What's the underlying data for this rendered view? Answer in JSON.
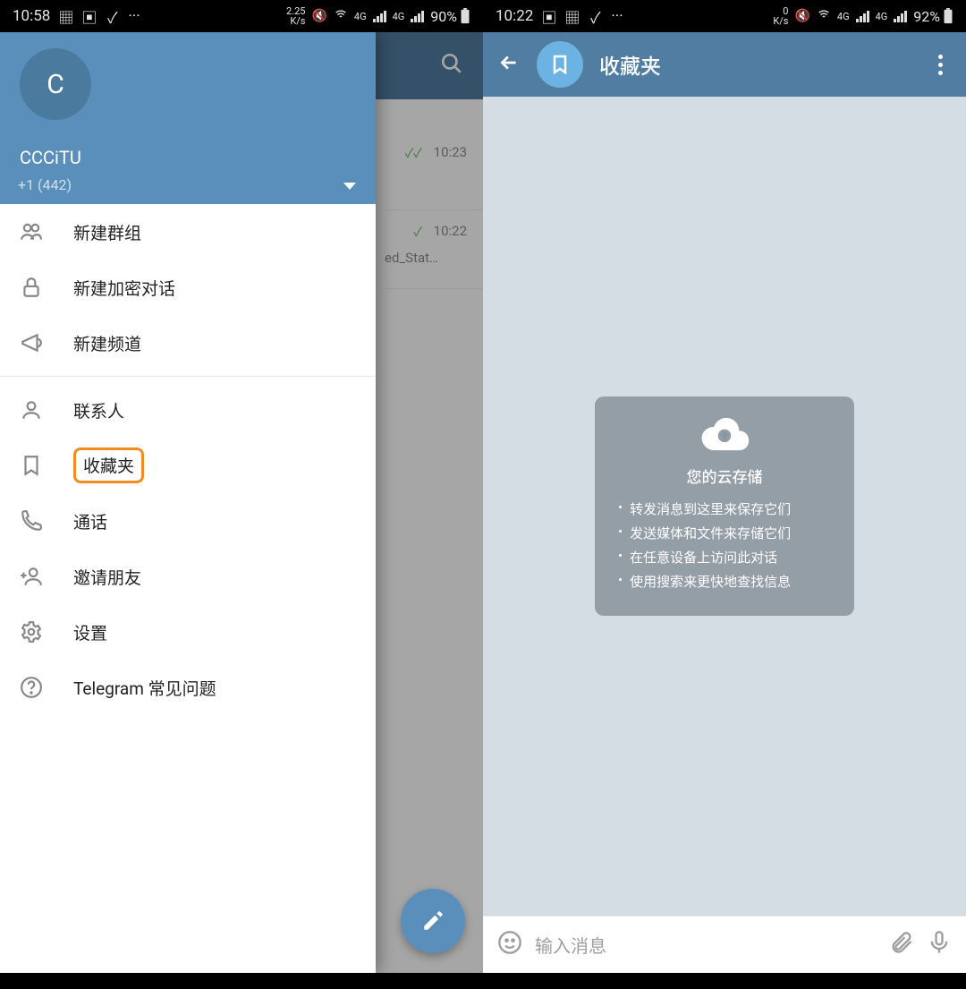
{
  "left": {
    "status": {
      "time": "10:58",
      "speed": "2.25\nK/s",
      "net": "4G",
      "battery_pct": "90%"
    },
    "chats": [
      {
        "read": "✓✓",
        "time": "10:23",
        "text": ""
      },
      {
        "read": "✓",
        "time": "10:22",
        "text": "ed_Stat…"
      }
    ],
    "drawer": {
      "avatar_initial": "C",
      "name": "CCCiTU",
      "phone": "+1 (442)",
      "items": [
        {
          "key": "new-group",
          "label": "新建群组"
        },
        {
          "key": "secret-chat",
          "label": "新建加密对话"
        },
        {
          "key": "new-channel",
          "label": "新建频道"
        },
        {
          "key": "contacts",
          "label": "联系人"
        },
        {
          "key": "saved",
          "label": "收藏夹",
          "highlight": true
        },
        {
          "key": "calls",
          "label": "通话"
        },
        {
          "key": "invite",
          "label": "邀请朋友"
        },
        {
          "key": "settings",
          "label": "设置"
        },
        {
          "key": "faq",
          "label": "Telegram 常见问题"
        }
      ]
    }
  },
  "right": {
    "status": {
      "time": "10:22",
      "speed": "0\nK/s",
      "net": "4G",
      "battery_pct": "92%"
    },
    "title": "收藏夹",
    "cloud": {
      "title": "您的云存储",
      "points": [
        "转发消息到这里来保存它们",
        "发送媒体和文件来存储它们",
        "在任意设备上访问此对话",
        "使用搜索来更快地查找信息"
      ]
    },
    "input_placeholder": "输入消息"
  }
}
